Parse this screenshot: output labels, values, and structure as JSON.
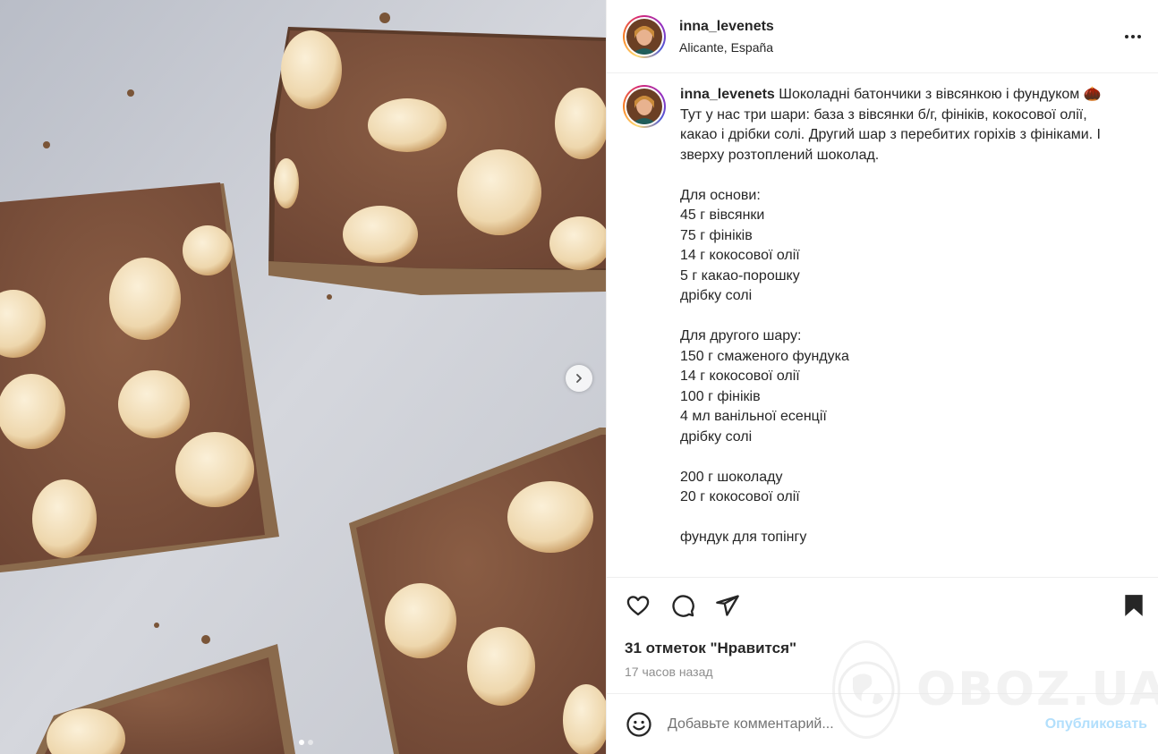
{
  "post": {
    "username": "inna_levenets",
    "location": "Alicante, España",
    "caption": {
      "username": "inna_levenets",
      "first_line": "Шоколадні батончики з вівсянкою і фундуком 🌰",
      "lines": [
        "Тут у нас три шари: база з вівсянки б/г, фініків, кокосової олії,",
        "какао і дрібки солі. Другий шар з перебитих горіхів з фініками. І",
        "зверху розтоплений шоколад.",
        "",
        "Для основи:",
        "45 г вівсянки",
        "75 г фініків",
        "14 г кокосової олії",
        "5 г какао-порошку",
        "дрібку солі",
        "",
        "Для другого шару:",
        "150 г смаженого фундука",
        "14 г кокосової олії",
        "100 г фініків",
        "4 мл ванільної есенції",
        "дрібку солі",
        "",
        "200 г шоколаду",
        "20 г кокосової олії",
        "",
        "фундук для топінгу"
      ]
    },
    "likes": "31 отметок \"Нравится\"",
    "time_ago": "17 часов назад",
    "comment_placeholder": "Добавьте комментарий...",
    "publish_label": "Опубликовать",
    "carousel": {
      "slides": 2,
      "active_index": 0
    }
  },
  "icons": {
    "like": "heart-icon",
    "comment": "comment-icon",
    "share": "send-icon",
    "save": "bookmark-icon",
    "emoji": "smiley-icon",
    "more": "more-options-icon",
    "next": "chevron-right-icon"
  },
  "watermark": {
    "text": "OBOZ.UA"
  },
  "colors": {
    "text": "#262626",
    "secondary": "#8e8e8e",
    "publish_disabled": "#b2dffc",
    "border": "#efefef"
  }
}
